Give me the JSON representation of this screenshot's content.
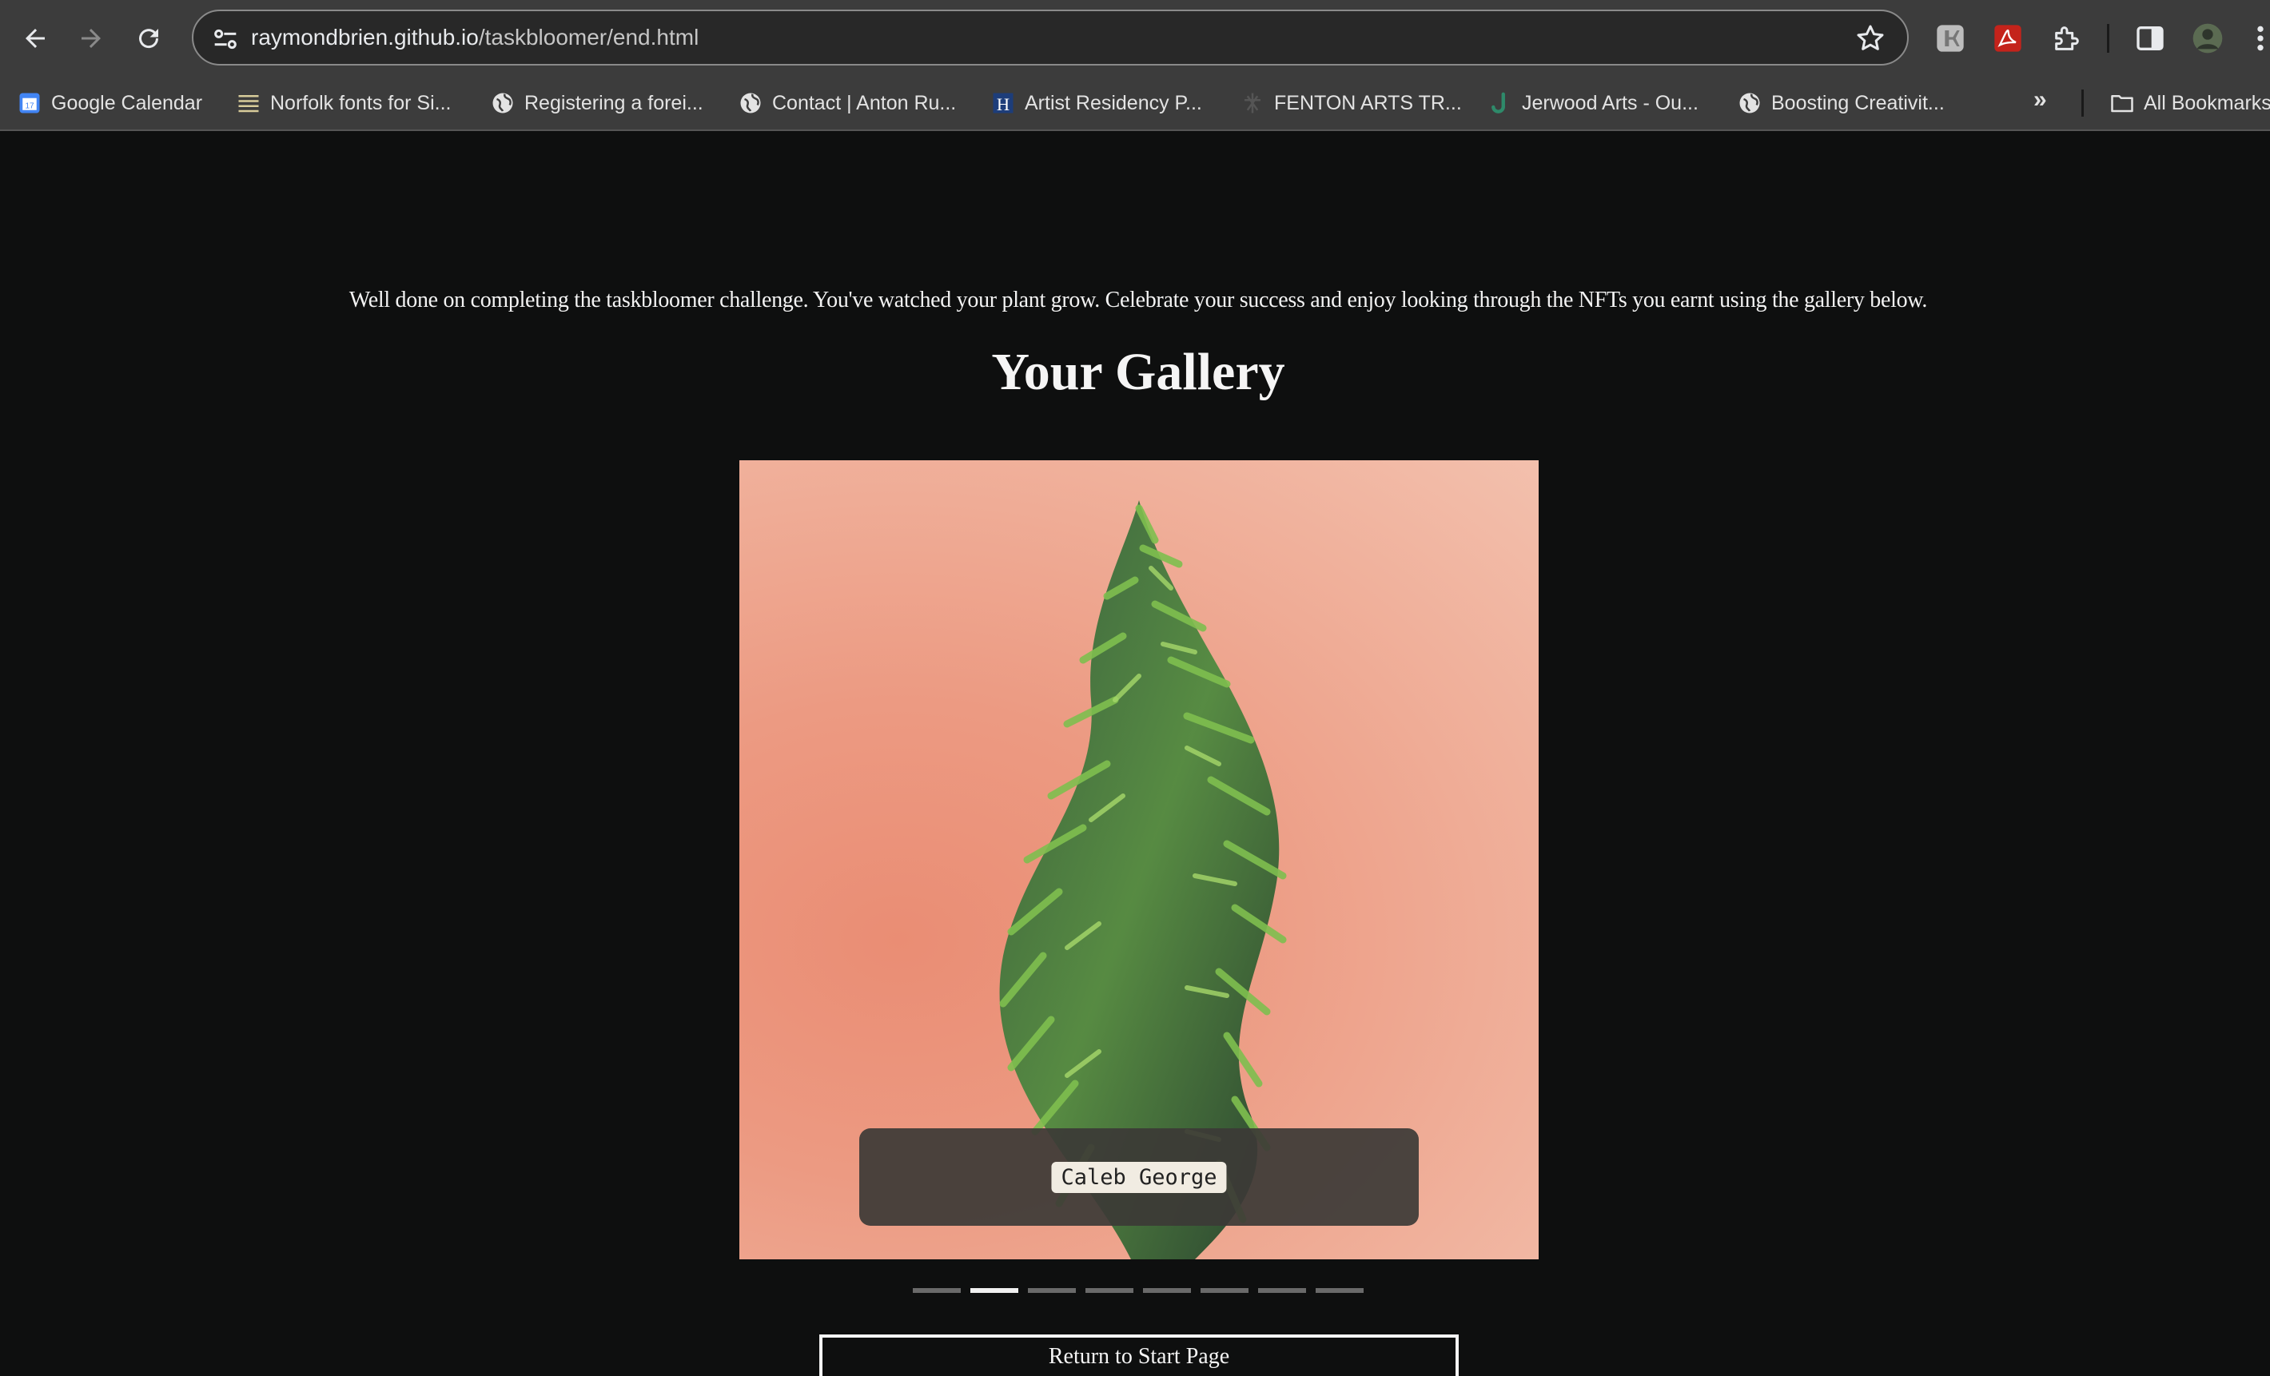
{
  "browser": {
    "url_host": "raymondbrien.github.io",
    "url_path": "/taskbloomer/end.html",
    "icons": {
      "back": "arrow-left-icon",
      "forward": "arrow-right-icon",
      "reload": "reload-icon",
      "site_info": "tune-icon",
      "bookmark_star": "star-icon",
      "extensions": "puzzle-icon",
      "side_panel": "side-panel-icon",
      "menu": "kebab-menu-icon"
    }
  },
  "bookmarks": {
    "items": [
      {
        "label": "Google Calendar",
        "icon": "calendar-icon"
      },
      {
        "label": "Norfolk fonts for Si...",
        "icon": "lines-icon"
      },
      {
        "label": "Registering a forei...",
        "icon": "globe-icon"
      },
      {
        "label": "Contact | Anton Ru...",
        "icon": "globe-icon"
      },
      {
        "label": "Artist Residency P...",
        "icon": "h-icon"
      },
      {
        "label": "FENTON ARTS TR...",
        "icon": "fenton-icon"
      },
      {
        "label": "Jerwood Arts - Ou...",
        "icon": "j-icon"
      },
      {
        "label": "Boosting Creativit...",
        "icon": "globe-icon"
      }
    ],
    "overflow": "»",
    "all_bookmarks": "All Bookmarks"
  },
  "page": {
    "intro": "Well done on completing the taskbloomer challenge. You've watched your plant grow. Celebrate your success and enjoy looking through the NFTs you earnt using the gallery below.",
    "gallery_title": "Your Gallery",
    "slide_caption": "Caleb George",
    "slide_count": 8,
    "active_slide": 2,
    "return_button": "Return to Start Page"
  },
  "colors": {
    "page_background": "#0e0f0f",
    "chrome_background": "#3c3c3c",
    "slide_background": "#ec9a82"
  }
}
